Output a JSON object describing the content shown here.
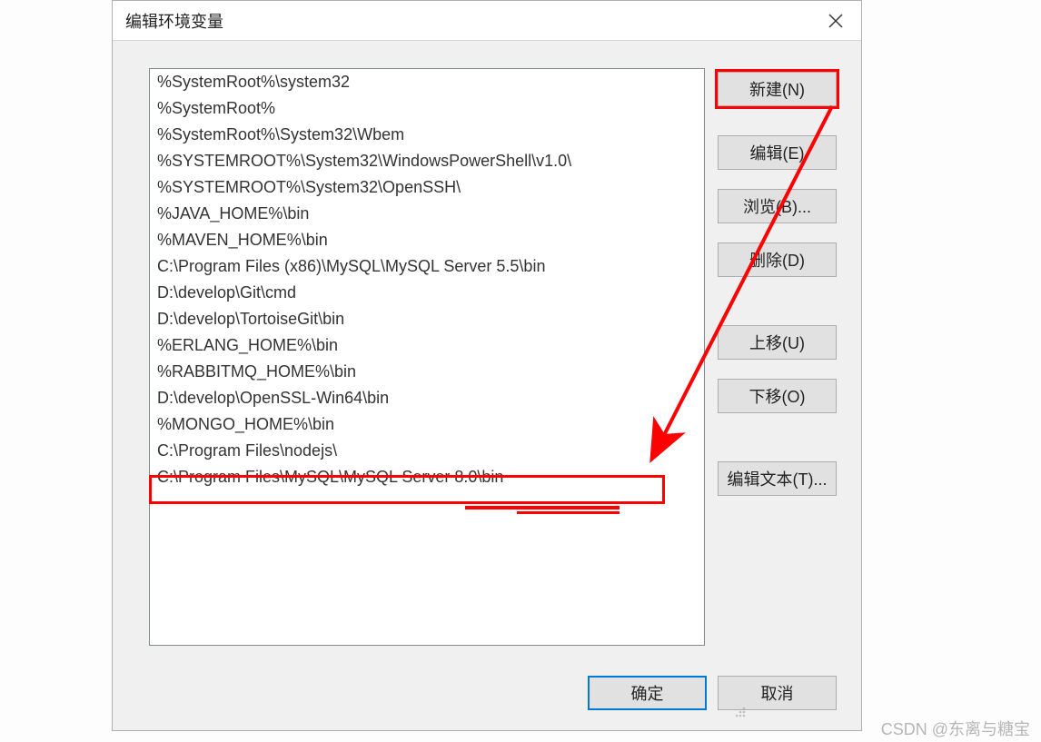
{
  "title": "编辑环境变量",
  "list": [
    "%SystemRoot%\\system32",
    "%SystemRoot%",
    "%SystemRoot%\\System32\\Wbem",
    "%SYSTEMROOT%\\System32\\WindowsPowerShell\\v1.0\\",
    "%SYSTEMROOT%\\System32\\OpenSSH\\",
    "%JAVA_HOME%\\bin",
    "%MAVEN_HOME%\\bin",
    "C:\\Program Files (x86)\\MySQL\\MySQL Server 5.5\\bin",
    "D:\\develop\\Git\\cmd",
    "D:\\develop\\TortoiseGit\\bin",
    "%ERLANG_HOME%\\bin",
    "%RABBITMQ_HOME%\\bin",
    "D:\\develop\\OpenSSL-Win64\\bin",
    "%MONGO_HOME%\\bin",
    "C:\\Program Files\\nodejs\\",
    "C:\\Program Files\\MySQL\\MySQL Server 8.0\\bin"
  ],
  "buttons": {
    "new": "新建(N)",
    "edit": "编辑(E)",
    "browse": "浏览(B)...",
    "delete": "删除(D)",
    "moveup": "上移(U)",
    "movedown": "下移(O)",
    "edittext": "编辑文本(T)...",
    "ok": "确定",
    "cancel": "取消"
  },
  "watermark": "CSDN @东离与糖宝"
}
